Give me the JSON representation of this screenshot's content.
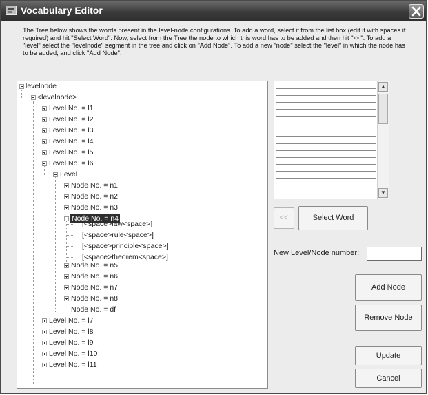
{
  "window": {
    "title": "Vocabulary Editor"
  },
  "description": "The Tree below shows the words present in the level-node configurations. To add a word, select it from the list box (edit it with spaces if required) and hit \"Select Word\". Now, select from the Tree the node to which this word has to be added and then hit \"<<\". To add a \"level\" select the \"levelnode\" segment in the tree and click on \"Add Node\". To add a new \"node\" select the \"level\" in which the node has to be added, and click \"Add Node\".",
  "tree": {
    "root": "levelnode",
    "root_child": "<levelnode>",
    "levels_before": [
      "Level No. = l1",
      "Level No. = l2",
      "Level No. = l3",
      "Level No. = l4",
      "Level No. = l5"
    ],
    "open_level": "Level No. = l6",
    "level_group": "Level",
    "nodes_before": [
      "Node No. = n1",
      "Node No. = n2",
      "Node No. = n3"
    ],
    "selected_node": "Node No. = n4",
    "words": [
      "[<space>law<space>]",
      "[<space>rule<space>]",
      "[<space>principle<space>]",
      "[<space>theorem<space>]"
    ],
    "nodes_after": [
      "Node No. = n5",
      "Node No. = n6",
      "Node No. = n7",
      "Node No. = n8"
    ],
    "last_node": "Node No. = df",
    "levels_after": [
      "Level No. = l7",
      "Level No. = l8",
      "Level No. = l9",
      "Level No. = l10",
      "Level No. = l11"
    ]
  },
  "buttons": {
    "add_word": "<<",
    "select_word": "Select Word",
    "add_node": "Add Node",
    "remove_node": "Remove Node",
    "update": "Update",
    "cancel": "Cancel"
  },
  "new_number": {
    "label": "New Level/Node number:",
    "value": ""
  },
  "icons": {
    "app": "app-icon",
    "close": "close-icon"
  }
}
